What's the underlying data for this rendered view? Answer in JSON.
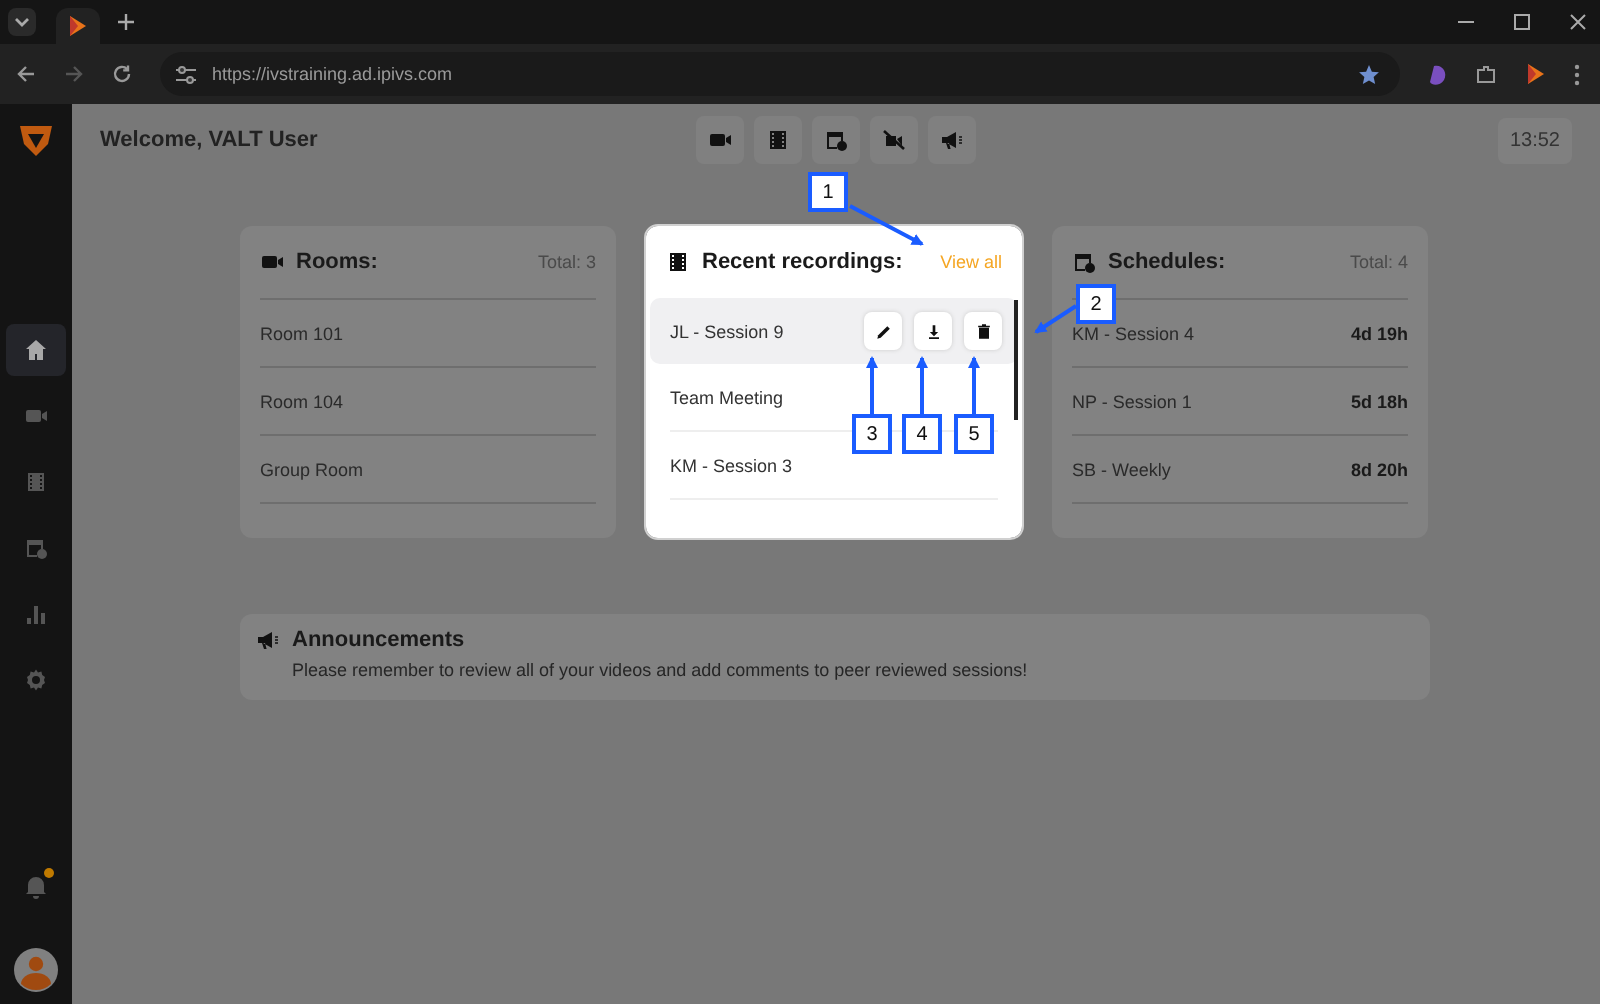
{
  "browser": {
    "url": "https://ivstraining.ad.ipivs.com"
  },
  "sidebar": {
    "items": [
      {
        "kind": "home",
        "selected": true
      },
      {
        "kind": "camera",
        "selected": false
      },
      {
        "kind": "film",
        "selected": false
      },
      {
        "kind": "schedule",
        "selected": false
      },
      {
        "kind": "chart",
        "selected": false
      },
      {
        "kind": "settings",
        "selected": false
      }
    ],
    "notifications_unread": true
  },
  "header": {
    "welcome": "Welcome, VALT User",
    "time": "13:52"
  },
  "rooms": {
    "title": "Rooms:",
    "total": "Total: 3",
    "items": [
      "Room 101",
      "Room 104",
      "Group Room"
    ]
  },
  "recordings": {
    "title": "Recent recordings:",
    "view_all": "View all",
    "items": [
      {
        "name": "JL - Session 9",
        "selected": true
      },
      {
        "name": "Team Meeting",
        "selected": false
      },
      {
        "name": "KM - Session 3",
        "selected": false
      }
    ]
  },
  "schedules": {
    "title": "Schedules:",
    "total": "Total: 4",
    "items": [
      {
        "name": "KM - Session 4",
        "time": "4d 19h"
      },
      {
        "name": "NP - Session 1",
        "time": "5d 18h"
      },
      {
        "name": "SB - Weekly",
        "time": "8d 20h"
      }
    ]
  },
  "announcements": {
    "title": "Announcements",
    "text": "Please remember to review all of your videos and add comments to peer reviewed sessions!"
  },
  "callouts": [
    "1",
    "2",
    "3",
    "4",
    "5"
  ]
}
